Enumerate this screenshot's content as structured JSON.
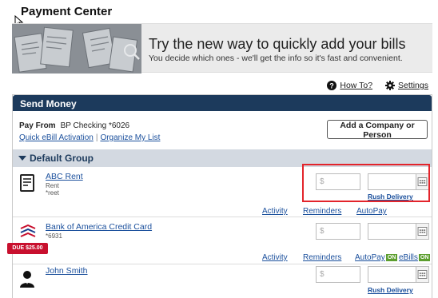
{
  "page": {
    "title": "Payment Center"
  },
  "promo": {
    "headline": "Try the new way to quickly add your bills",
    "subtext": "You decide which ones - we'll get the info so it's fast and convenient."
  },
  "utility": {
    "howto_label": "How To?",
    "howto_icon": "question-circle-icon",
    "settings_label": "Settings",
    "settings_icon": "gear-icon"
  },
  "panel": {
    "title": "Send Money",
    "pay_from_label": "Pay From",
    "pay_from_account": "BP Checking *6026",
    "quick_ebill_link": "Quick eBill Activation",
    "organize_link": "Organize My List",
    "add_button": "Add a Company or Person"
  },
  "group": {
    "name": "Default Group"
  },
  "payees": [
    {
      "name": "ABC Rent",
      "meta1": "Rent",
      "meta2": "*reet",
      "icon": "bill-document-icon",
      "amount_placeholder": "$",
      "rush_label": "Rush Delivery",
      "links": {
        "activity": "Activity",
        "reminders": "Reminders",
        "autopay": "AutoPay"
      }
    },
    {
      "name": "Bank of America Credit Card",
      "meta1": "*6931",
      "icon": "bank-of-america-logo-icon",
      "amount_placeholder": "$",
      "due_badge": "DUE $25.00",
      "links": {
        "activity": "Activity",
        "reminders": "Reminders",
        "autopay": "AutoPay",
        "autopay_badge": "ON",
        "ebills": "eBills",
        "ebills_badge": "ON"
      }
    },
    {
      "name": "John Smith",
      "icon": "person-avatar-icon",
      "amount_placeholder": "$",
      "rush_label": "Rush Delivery"
    }
  ],
  "colors": {
    "header": "#1c3a5c",
    "group_bg": "#d3d9e1",
    "link": "#1a4f9c",
    "due": "#c8102e",
    "on_badge": "#5c9e2e",
    "highlight": "#e3242b"
  }
}
